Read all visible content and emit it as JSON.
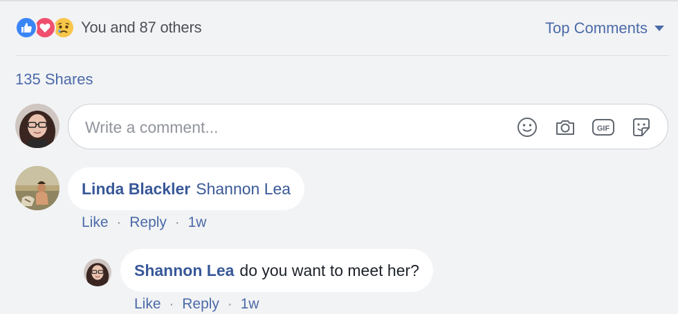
{
  "reactions": {
    "icons": [
      "like-icon",
      "love-icon",
      "sad-icon"
    ],
    "colors": {
      "like": "#3b86f6",
      "love": "#f0506e",
      "sad": "#f7c64a"
    },
    "summary": "You and 87 others"
  },
  "sort": {
    "label": "Top Comments",
    "icon": "caret-down-icon"
  },
  "shares": {
    "label": "135 Shares"
  },
  "composer": {
    "placeholder": "Write a comment...",
    "tools": [
      "emoji-icon",
      "camera-icon",
      "gif-icon",
      "sticker-icon"
    ]
  },
  "comments": [
    {
      "author": "Linda Blackler",
      "mention": "Shannon Lea",
      "text": "",
      "actions": {
        "like": "Like",
        "reply": "Reply",
        "time": "1w",
        "sep": "·"
      }
    },
    {
      "author": "Shannon Lea",
      "mention": "",
      "text": "do you want to meet her?",
      "actions": {
        "like": "Like",
        "reply": "Reply",
        "time": "1w",
        "sep": "·"
      }
    }
  ],
  "theme": {
    "link": "#385898",
    "background": "#f2f3f5"
  }
}
